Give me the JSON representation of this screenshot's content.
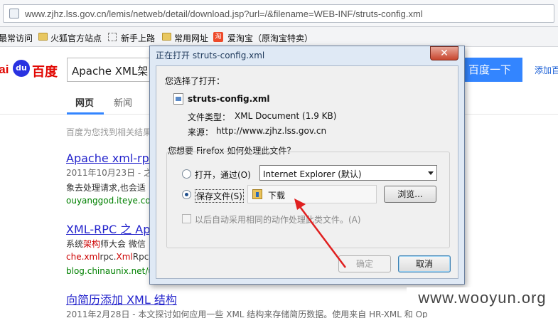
{
  "browser": {
    "url": "www.zjhz.lss.gov.cn/lemis/netweb/detail/download.jsp?url=/&filename=WEB-INF/struts-config.xml",
    "bookmarks": [
      "最常访问",
      "火狐官方站点",
      "新手上路",
      "常用网址",
      "爱淘宝（原淘宝特卖）"
    ],
    "taobao_icon": "淘"
  },
  "baidu": {
    "logo_bai": "Bai",
    "logo_du": "du",
    "logo_cn": "百度",
    "search_value": "Apache XML架",
    "search_button": "百度一下",
    "login_link": "添加百",
    "tabs": [
      "网页",
      "新闻"
    ],
    "result_count": "百度为您找到相关结果",
    "results": [
      {
        "title": "Apache xml-rpc架",
        "line1": "2011年10月23日 - 之",
        "line2": "象去处理请求,也会适",
        "url": "ouyanggod.iteye.com"
      },
      {
        "title": "XML-RPC 之 Ap",
        "line1_pre": "系统",
        "line1_em": "架构",
        "line1_post": "师大会 微信",
        "line2_a": "che.",
        "line2_b": "xml",
        "line2_c": "rpc.",
        "line2_d": "Xml",
        "line2_e": "RpcS",
        "url": "blog.chinaunix.net/u"
      },
      {
        "title": "向简历添加 XML 结构",
        "line1": "2011年2月28日 - 本文探讨如何应用一些 XML 结构来存储简历数据。使用来自 HR-XML 和 Op"
      }
    ]
  },
  "dialog": {
    "title": "正在打开 struts-config.xml",
    "close": "✕",
    "chose_to_open": "您选择了打开：",
    "filename": "struts-config.xml",
    "filetype_label": "文件类型：",
    "filetype_value": "XML Document (1.9 KB)",
    "source_label": "来源：",
    "source_value": "http://www.zjhz.lss.gov.cn",
    "question": "您想要 Firefox 如何处理此文件？",
    "open_with_label": "打开，通过(O)",
    "open_with_value": "Internet Explorer (默认)",
    "save_label": "保存文件(S)",
    "save_location": "下载",
    "browse_button": "浏览...",
    "auto_label": "以后自动采用相同的动作处理此类文件。(A)",
    "ok_button": "确定",
    "cancel_button": "取消",
    "selected_option": "save"
  },
  "watermark": "www.wooyun.org",
  "colors": {
    "baidu_blue": "#3385ff",
    "annotation_arrow": "#e02020"
  }
}
